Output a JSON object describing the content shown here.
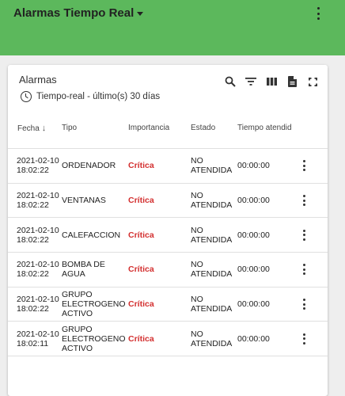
{
  "appbar": {
    "title": "Alarmas Tiempo Real",
    "title_icon": "caret-down-icon",
    "menu_icon": "more-vert-icon"
  },
  "card": {
    "title": "Alarmas",
    "subtitle": "Tiempo-real - último(s) 30 días",
    "subtitle_icon": "clock-icon",
    "tools": [
      "search-icon",
      "filter-icon",
      "columns-icon",
      "export-pdf-icon",
      "fullscreen-icon"
    ]
  },
  "table": {
    "headers": {
      "fecha": "Fecha",
      "tipo": "Tipo",
      "importancia": "Importancia",
      "estado": "Estado",
      "tiempo": "Tiempo atendido"
    },
    "sort": {
      "column": "fecha",
      "direction": "descending",
      "icon": "arrow-down-icon"
    },
    "rows": [
      {
        "fecha": "2021-02-10 18:02:22",
        "tipo": "ORDENADOR",
        "importancia": "Crítica",
        "estado": "NO ATENDIDA",
        "tiempo": "00:00:00"
      },
      {
        "fecha": "2021-02-10 18:02:22",
        "tipo": "VENTANAS",
        "importancia": "Crítica",
        "estado": "NO ATENDIDA",
        "tiempo": "00:00:00"
      },
      {
        "fecha": "2021-02-10 18:02:22",
        "tipo": "CALEFACCION",
        "importancia": "Crítica",
        "estado": "NO ATENDIDA",
        "tiempo": "00:00:00"
      },
      {
        "fecha": "2021-02-10 18:02:22",
        "tipo": "BOMBA DE AGUA",
        "importancia": "Crítica",
        "estado": "NO ATENDIDA",
        "tiempo": "00:00:00"
      },
      {
        "fecha": "2021-02-10 18:02:22",
        "tipo": "GRUPO ELECTROGENO ACTIVO",
        "importancia": "Crítica",
        "estado": "NO ATENDIDA",
        "tiempo": "00:00:00"
      },
      {
        "fecha": "2021-02-10 18:02:11",
        "tipo": "GRUPO ELECTROGENO ACTIVO",
        "importancia": "Crítica",
        "estado": "NO ATENDIDA",
        "tiempo": "00:00:00"
      }
    ]
  },
  "colors": {
    "appbar": "#5cb85c",
    "critical": "#d32f2f"
  }
}
